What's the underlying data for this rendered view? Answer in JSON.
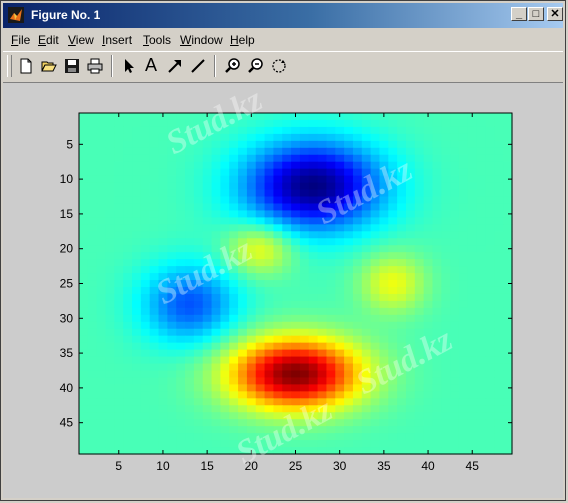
{
  "window": {
    "title": "Figure No. 1",
    "controls": {
      "minimize": "_",
      "maximize": "□",
      "close": "✕"
    }
  },
  "menu": [
    {
      "label": "File",
      "key": "F",
      "rest": "ile"
    },
    {
      "label": "Edit",
      "key": "E",
      "rest": "dit"
    },
    {
      "label": "View",
      "key": "V",
      "rest": "iew"
    },
    {
      "label": "Insert",
      "key": "I",
      "rest": "nsert"
    },
    {
      "label": "Tools",
      "key": "T",
      "rest": "ools"
    },
    {
      "label": "Window",
      "key": "W",
      "rest": "indow"
    },
    {
      "label": "Help",
      "key": "H",
      "rest": "elp"
    }
  ],
  "toolbar": {
    "icons": [
      "new-file-icon",
      "open-folder-icon",
      "save-icon",
      "print-icon",
      "select-arrow-icon",
      "insert-text-icon",
      "insert-arrow-icon",
      "insert-line-icon",
      "zoom-in-icon",
      "zoom-out-icon",
      "rotate-3d-icon"
    ],
    "text_tool_label": "A"
  },
  "watermark": [
    "Stud.kz",
    "Stud.kz",
    "Stud.kz",
    "Stud.kz",
    "Stud.kz"
  ],
  "chart_data": {
    "type": "heatmap",
    "colormap": "jet",
    "grid": false,
    "xlim": [
      0.5,
      49.5
    ],
    "ylim": [
      0.5,
      49.5
    ],
    "y_reversed": true,
    "xticks": [
      5,
      10,
      15,
      20,
      25,
      30,
      35,
      40,
      45
    ],
    "yticks": [
      5,
      10,
      15,
      20,
      25,
      30,
      35,
      40,
      45
    ],
    "color_range": [
      -6.5,
      8.1
    ],
    "features": [
      {
        "kind": "minimum",
        "x": 27,
        "y": 11,
        "value": -6.5,
        "sx": 5.5,
        "sy": 4.5
      },
      {
        "kind": "minimum",
        "x": 13,
        "y": 28,
        "value": -3.5,
        "sx": 3.8,
        "sy": 4.0
      },
      {
        "kind": "maximum",
        "x": 25,
        "y": 38,
        "value": 8.1,
        "sx": 5.2,
        "sy": 3.6
      },
      {
        "kind": "maximum",
        "x": 21,
        "y": 20,
        "value": 2.6,
        "sx": 2.6,
        "sy": 2.6
      },
      {
        "kind": "maximum",
        "x": 36,
        "y": 25,
        "value": 2.4,
        "sx": 2.6,
        "sy": 3.0
      }
    ]
  }
}
